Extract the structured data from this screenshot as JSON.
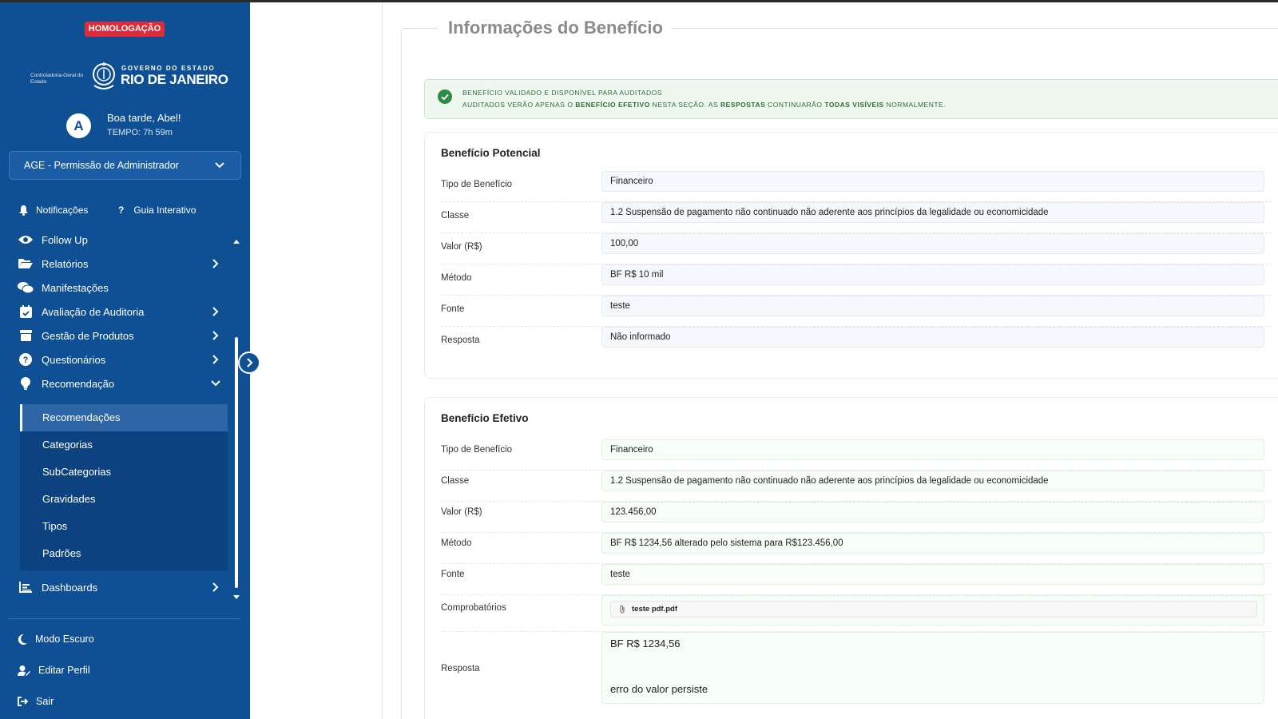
{
  "env_badge": "HOMOLOGAÇÃO",
  "logo": {
    "org": "Controladoria-Geral do Estado",
    "gov_line1": "GOVERNO DO ESTADO",
    "gov_line2": "RIO DE JANEIRO"
  },
  "user": {
    "avatar_letter": "A",
    "greeting": "Boa tarde, Abel!",
    "session_time": "TEMPO: 7h 59m"
  },
  "permission_select": {
    "value": "AGE - Permissão de Administrador"
  },
  "quick_links": {
    "notifications": "Notificações",
    "guide": "Guia Interativo"
  },
  "menu": {
    "follow_up": "Follow Up",
    "reports": "Relatórios",
    "manifestations": "Manifestações",
    "audit_eval": "Avaliação de Auditoria",
    "product_mgmt": "Gestão de Produtos",
    "questionnaires": "Questionários",
    "recommendation": "Recomendação",
    "dashboards": "Dashboards"
  },
  "submenu": [
    "Recomendações",
    "Categorias",
    "SubCategorias",
    "Gravidades",
    "Tipos",
    "Padrões"
  ],
  "bottom_menu": {
    "dark_mode": "Modo Escuro",
    "edit_profile": "Editar Perfil",
    "logout": "Sair"
  },
  "main": {
    "section_title": "Informações do Benefício",
    "alert": {
      "line1": "BENEFÍCIO VALIDADO E DISPONÍVEL PARA AUDITADOS",
      "line2_a": "AUDITADOS VERÃO APENAS O ",
      "line2_b": "BENEFÍCIO EFETIVO",
      "line2_c": " NESTA SEÇÃO. AS ",
      "line2_d": "RESPOSTAS",
      "line2_e": " CONTINUARÃO ",
      "line2_f": "TODAS VISÍVEIS",
      "line2_g": " NORMALMENTE."
    },
    "potential": {
      "title": "Benefício Potencial",
      "labels": {
        "type": "Tipo de Benefício",
        "class": "Classe",
        "value": "Valor (R$)",
        "method": "Método",
        "source": "Fonte",
        "answer": "Resposta"
      },
      "values": {
        "type": "Financeiro",
        "class": "1.2 Suspensão de pagamento não continuado não aderente aos princípios da legalidade ou economicidade",
        "value": "100,00",
        "method": "BF R$ 10 mil",
        "source": "teste",
        "answer": "Não informado"
      }
    },
    "effective": {
      "title": "Benefício Efetivo",
      "labels": {
        "type": "Tipo de Benefício",
        "class": "Classe",
        "value": "Valor (R$)",
        "method": "Método",
        "source": "Fonte",
        "attachments": "Comprobatórios",
        "answer": "Resposta"
      },
      "values": {
        "type": "Financeiro",
        "class": "1.2 Suspensão de pagamento não continuado não aderente aos princípios da legalidade ou economicidade",
        "value": "123.456,00",
        "method": "BF R$ 1234,56 alterado pelo sistema para R$123.456,00",
        "source": "teste",
        "attachment_file": "teste pdf.pdf",
        "answer_line1": "BF R$ 1234,56",
        "answer_line2": "erro do valor persiste"
      }
    }
  }
}
